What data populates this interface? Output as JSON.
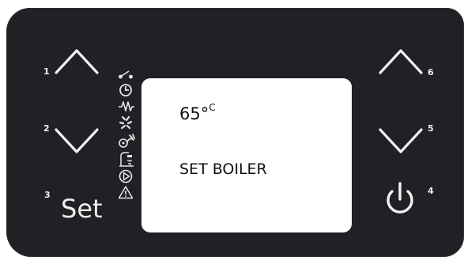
{
  "display": {
    "temperature": "65°",
    "temperature_unit": "C",
    "mode_text": "SET BOILER"
  },
  "buttons": {
    "b1": {
      "number": "1",
      "icon": "chevron-up-icon"
    },
    "b2": {
      "number": "2",
      "icon": "chevron-down-icon"
    },
    "b3": {
      "number": "3",
      "label": "Set"
    },
    "b4": {
      "number": "4",
      "icon": "power-icon"
    },
    "b5": {
      "number": "5",
      "icon": "chevron-down-icon"
    },
    "b6": {
      "number": "6",
      "icon": "chevron-up-icon"
    }
  },
  "indicators": [
    "switch-icon",
    "clock-icon",
    "heating-icon",
    "flame-icon",
    "boiler-icon",
    "shower-icon",
    "pump-icon",
    "warning-icon"
  ],
  "colors": {
    "panel": "#202124",
    "screen": "#ffffff",
    "button_glyph": "#f2f2f2"
  }
}
